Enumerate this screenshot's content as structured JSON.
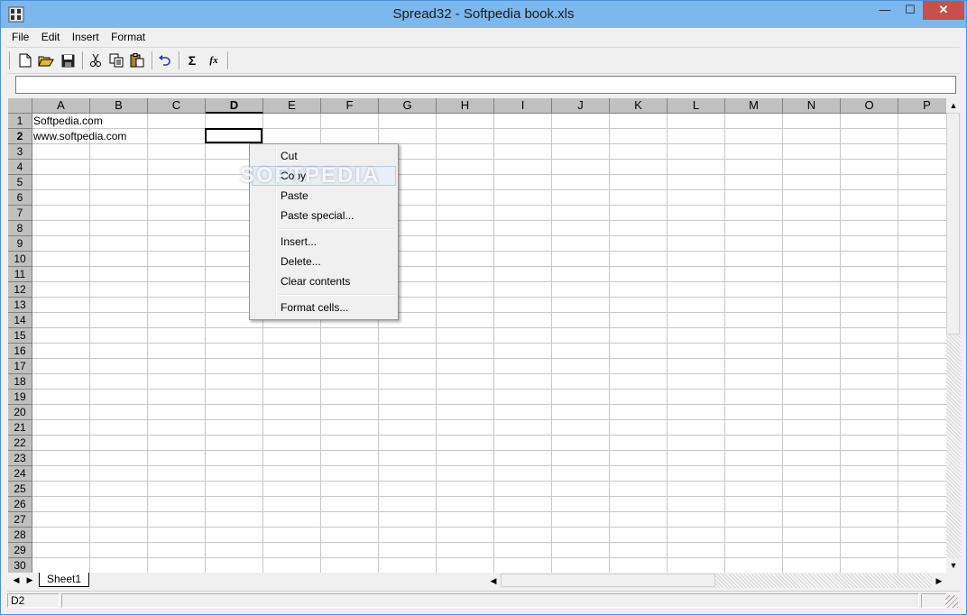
{
  "window": {
    "title": "Spread32 - Softpedia book.xls"
  },
  "menu": [
    "File",
    "Edit",
    "Insert",
    "Format"
  ],
  "toolbar": {
    "tools": [
      "new-file-icon",
      "open-folder-icon",
      "save-icon",
      "cut-icon",
      "copy-icon",
      "paste-icon",
      "undo-icon",
      "sum-icon",
      "function-icon"
    ],
    "sum_glyph": "Σ",
    "function_glyph": "fx"
  },
  "formula_bar": {
    "value": ""
  },
  "grid": {
    "columns": [
      "A",
      "B",
      "C",
      "D",
      "E",
      "F",
      "G",
      "H",
      "I",
      "J",
      "K",
      "L",
      "M",
      "N",
      "O",
      "P"
    ],
    "selected_column": "D",
    "rows": [
      "1",
      "2",
      "3",
      "4",
      "5",
      "6",
      "7",
      "8",
      "9",
      "10",
      "11",
      "12",
      "13",
      "14",
      "15",
      "16",
      "17",
      "18",
      "19",
      "20",
      "21",
      "22",
      "23",
      "24",
      "25",
      "26",
      "27",
      "28",
      "29",
      "30"
    ],
    "selected_row": "2",
    "cells": {
      "A1": "Softpedia.com",
      "A2": "www.softpedia.com"
    },
    "active_cell": "D2"
  },
  "context_menu": {
    "items": [
      {
        "label": "Cut"
      },
      {
        "label": "Copy",
        "highlighted": true
      },
      {
        "label": "Paste"
      },
      {
        "label": "Paste special..."
      },
      {
        "label": "Insert..."
      },
      {
        "label": "Delete..."
      },
      {
        "label": "Clear contents"
      },
      {
        "label": "Format cells..."
      }
    ]
  },
  "watermark": "SOFTPEDIA",
  "sheets": [
    "Sheet1"
  ],
  "status": {
    "cell_ref": "D2"
  },
  "colors": {
    "title_bar": "#7ab8ee",
    "close_button": "#c7504b",
    "header_gray": "#c0c0c0",
    "menu_highlight": "#e7f0f9"
  }
}
